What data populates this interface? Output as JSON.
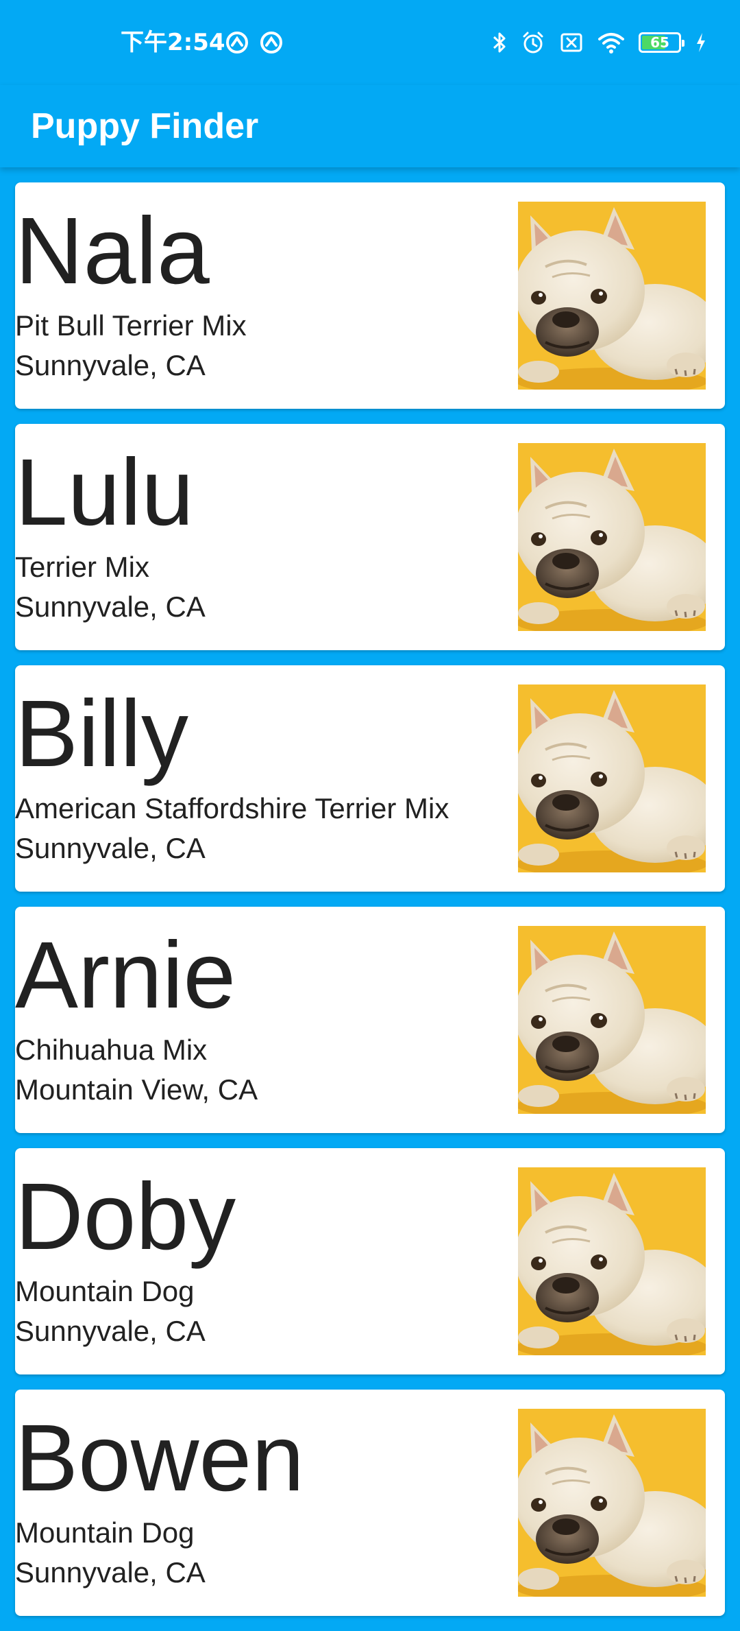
{
  "status_bar": {
    "time": "下午2:54",
    "left_icons": [
      "sync-icon",
      "sync-icon"
    ],
    "right_icons": [
      "bluetooth-icon",
      "alarm-icon",
      "sim-off-icon",
      "wifi-icon"
    ],
    "battery_level": "65",
    "battery_fraction": 0.65,
    "charging_icon": "bolt-icon"
  },
  "app_bar": {
    "title": "Puppy Finder",
    "color": "#03A9F4"
  },
  "puppies": [
    {
      "name": "Nala",
      "breed": "Pit Bull Terrier Mix",
      "location": "Sunnyvale, CA"
    },
    {
      "name": "Lulu",
      "breed": "Terrier Mix",
      "location": "Sunnyvale, CA"
    },
    {
      "name": "Billy",
      "breed": "American Staffordshire Terrier Mix",
      "location": "Sunnyvale, CA"
    },
    {
      "name": "Arnie",
      "breed": "Chihuahua Mix",
      "location": "Mountain View, CA"
    },
    {
      "name": "Doby",
      "breed": "Mountain Dog",
      "location": "Sunnyvale, CA"
    },
    {
      "name": "Bowen",
      "breed": "Mountain Dog",
      "location": "Sunnyvale, CA"
    }
  ],
  "colors": {
    "primary": "#03A9F4",
    "card": "#ffffff",
    "text": "#212121",
    "photo_background": "#F5BE2E",
    "battery_fill": "#4CD964"
  }
}
